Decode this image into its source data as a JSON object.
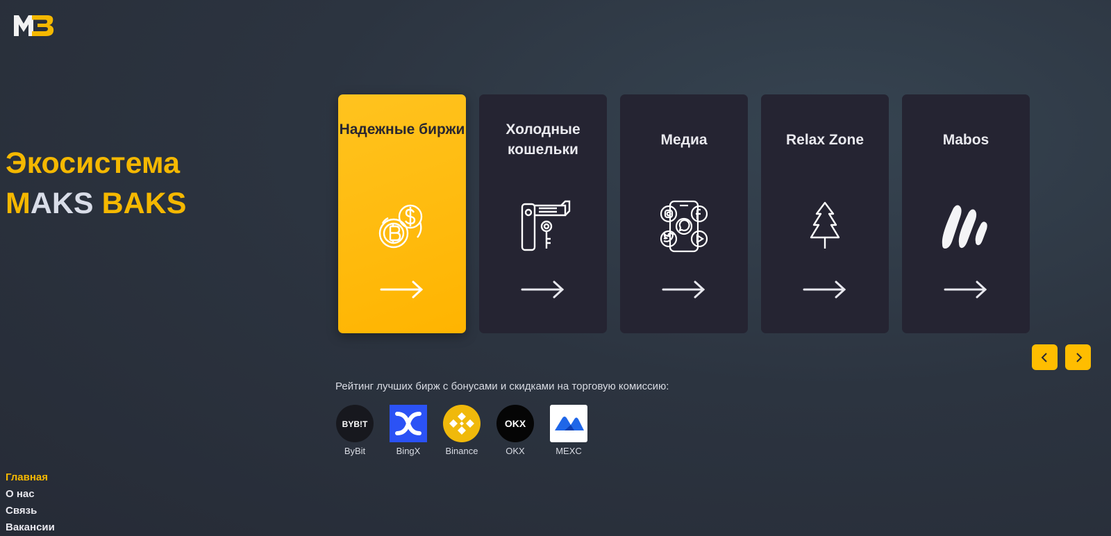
{
  "logo": {
    "letters": "MB"
  },
  "hero": {
    "line1": "Экосистема",
    "line2_m": "M",
    "line2_aks": "AKS",
    "line2_baks": "BAKS"
  },
  "cards": [
    {
      "title": "Надежные биржи",
      "icon": "crypto-coins-icon",
      "active": true
    },
    {
      "title": "Холодные кошельки",
      "icon": "cold-wallet-icon",
      "active": false
    },
    {
      "title": "Медиа",
      "icon": "social-media-phone-icon",
      "active": false
    },
    {
      "title": "Relax Zone",
      "icon": "pine-tree-icon",
      "active": false
    },
    {
      "title": "Mabos",
      "icon": "mabos-logo-icon",
      "active": false
    }
  ],
  "carousel": {
    "prev_icon": "chevron-left-icon",
    "next_icon": "chevron-right-icon"
  },
  "rating": {
    "text": "Рейтинг лучших бирж с бонусами и скидками на торговую комиссию:"
  },
  "exchanges": [
    {
      "name": "ByBit",
      "logo_text": "BYB!T"
    },
    {
      "name": "BingX",
      "logo_text": ""
    },
    {
      "name": "Binance",
      "logo_text": ""
    },
    {
      "name": "OKX",
      "logo_text": "OKX"
    },
    {
      "name": "MEXC",
      "logo_text": ""
    }
  ],
  "menu": [
    "Главная",
    "О нас",
    "Связь",
    "Вакансии"
  ],
  "colors": {
    "accent": "#ffbd00",
    "card_bg": "#252432",
    "background": "#2c3440"
  }
}
